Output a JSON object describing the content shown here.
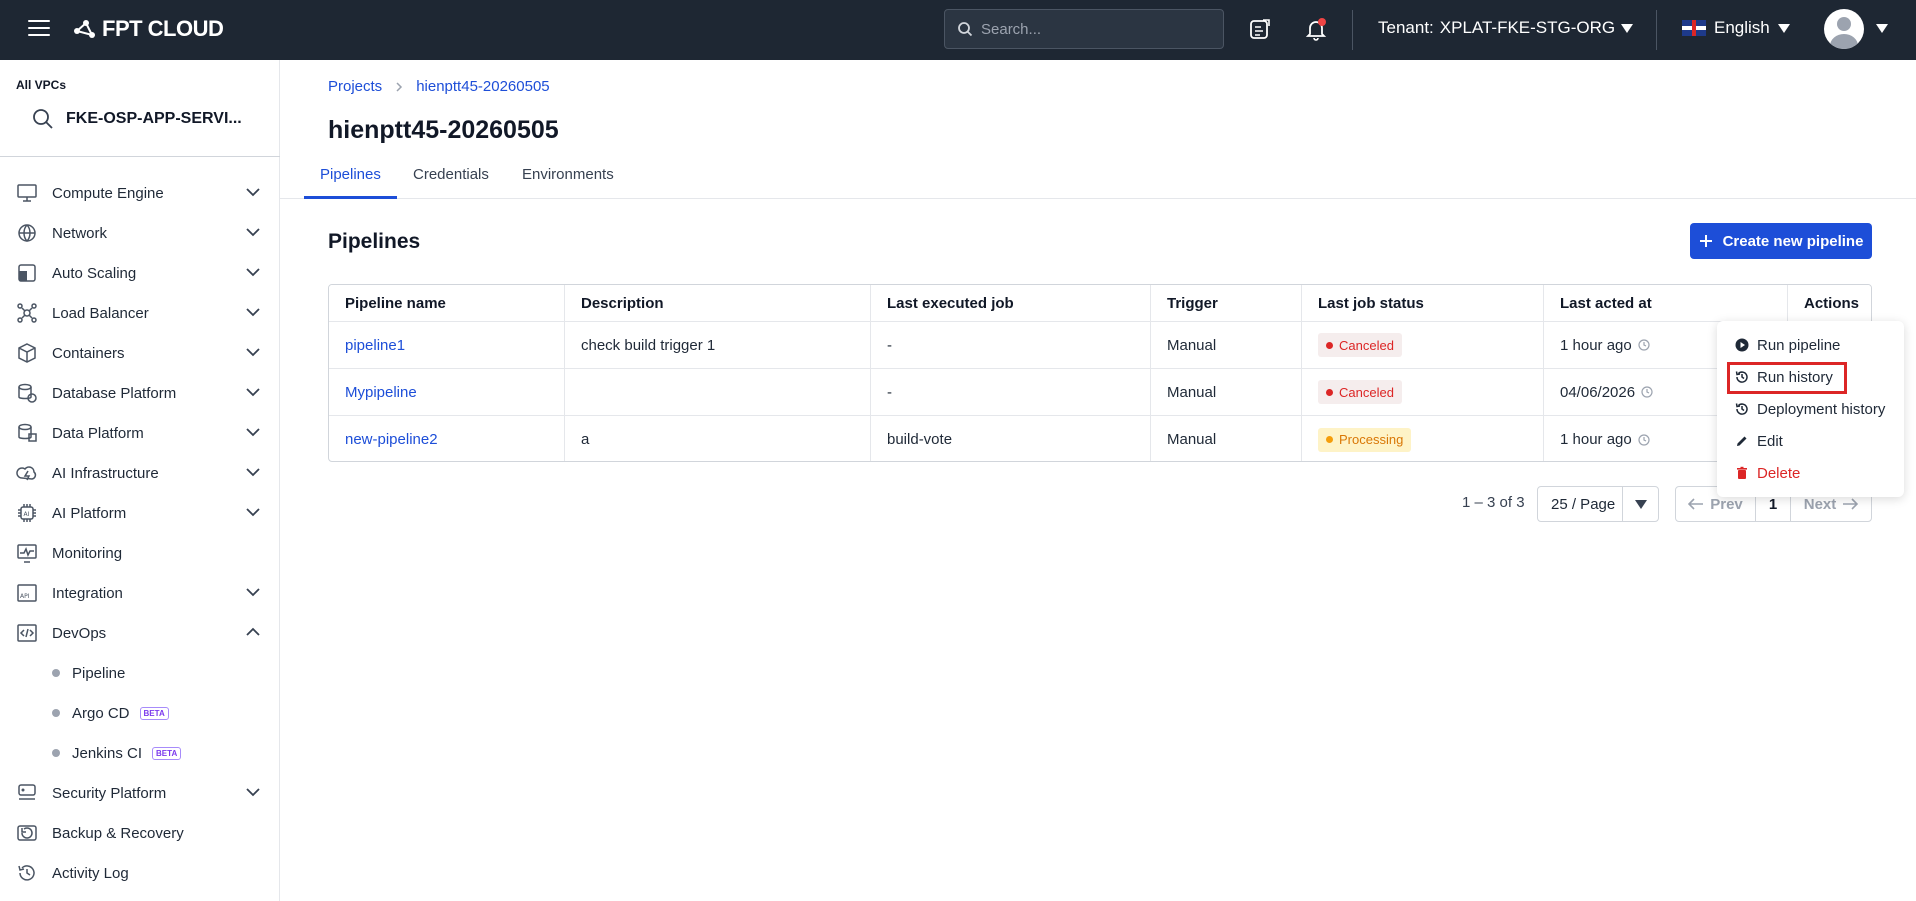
{
  "header": {
    "logo_text": "FPT CLOUD",
    "search_placeholder": "Search...",
    "tenant_label": "Tenant:",
    "tenant_value": "XPLAT-FKE-STG-ORG",
    "language": "English"
  },
  "sidebar": {
    "vpc_label": "All VPCs",
    "vpc_value": "FKE-OSP-APP-SERVI...",
    "items": [
      {
        "label": "Compute Engine",
        "icon": "monitor-icon",
        "expandable": true
      },
      {
        "label": "Network",
        "icon": "globe-icon",
        "expandable": true
      },
      {
        "label": "Auto Scaling",
        "icon": "auto-scaling-icon",
        "expandable": true
      },
      {
        "label": "Load Balancer",
        "icon": "load-balancer-icon",
        "expandable": true
      },
      {
        "label": "Containers",
        "icon": "box-icon",
        "expandable": true
      },
      {
        "label": "Database Platform",
        "icon": "database-icon",
        "expandable": true
      },
      {
        "label": "Data Platform",
        "icon": "data-platform-icon",
        "expandable": true
      },
      {
        "label": "AI Infrastructure",
        "icon": "ai-infrastructure-icon",
        "expandable": true
      },
      {
        "label": "AI Platform",
        "icon": "ai-chip-icon",
        "expandable": true
      },
      {
        "label": "Monitoring",
        "icon": "monitoring-icon",
        "expandable": false
      },
      {
        "label": "Integration",
        "icon": "api-icon",
        "expandable": true
      },
      {
        "label": "DevOps",
        "icon": "devops-icon",
        "expandable": true,
        "expanded": true
      }
    ],
    "devops_sub": [
      {
        "label": "Pipeline",
        "beta": ""
      },
      {
        "label": "Argo CD",
        "beta": "BETA"
      },
      {
        "label": "Jenkins CI",
        "beta": "BETA"
      }
    ],
    "items_after": [
      {
        "label": "Security Platform",
        "icon": "shield-icon",
        "expandable": true
      },
      {
        "label": "Backup & Recovery",
        "icon": "backup-icon",
        "expandable": false
      },
      {
        "label": "Activity Log",
        "icon": "history-icon",
        "expandable": false
      }
    ]
  },
  "breadcrumb": {
    "root": "Projects",
    "current": "hienptt45-20260505"
  },
  "page_title": "hienptt45-20260505",
  "tabs": [
    "Pipelines",
    "Credentials",
    "Environments"
  ],
  "section_title": "Pipelines",
  "create_button": "Create new pipeline",
  "table": {
    "columns": [
      "Pipeline name",
      "Description",
      "Last executed job",
      "Trigger",
      "Last job status",
      "Last acted at",
      "Actions"
    ],
    "rows": [
      {
        "name": "pipeline1",
        "description": "check build trigger 1",
        "last_job": "-",
        "trigger": "Manual",
        "status": "Canceled",
        "status_kind": "canceled",
        "acted": "1 hour ago"
      },
      {
        "name": "Mypipeline",
        "description": "",
        "last_job": "-",
        "trigger": "Manual",
        "status": "Canceled",
        "status_kind": "canceled",
        "acted": "04/06/2026"
      },
      {
        "name": "new-pipeline2",
        "description": "a",
        "last_job": "build-vote",
        "trigger": "Manual",
        "status": "Processing",
        "status_kind": "processing",
        "acted": "1 hour ago"
      }
    ]
  },
  "pagination": {
    "range": "1 – 3 of 3",
    "page_size": "25 / Page",
    "prev": "Prev",
    "page": "1",
    "next": "Next"
  },
  "actions_menu": [
    {
      "label": "Run pipeline",
      "icon": "play-icon"
    },
    {
      "label": "Run history",
      "icon": "history-icon",
      "highlighted": true
    },
    {
      "label": "Deployment history",
      "icon": "history-icon"
    },
    {
      "label": "Edit",
      "icon": "pencil-icon"
    },
    {
      "label": "Delete",
      "icon": "trash-icon",
      "danger": true
    }
  ],
  "colors": {
    "accent": "#1d4ed8",
    "topbar": "#1e2733",
    "danger": "#dc2626",
    "warning": "#f59e0b"
  }
}
